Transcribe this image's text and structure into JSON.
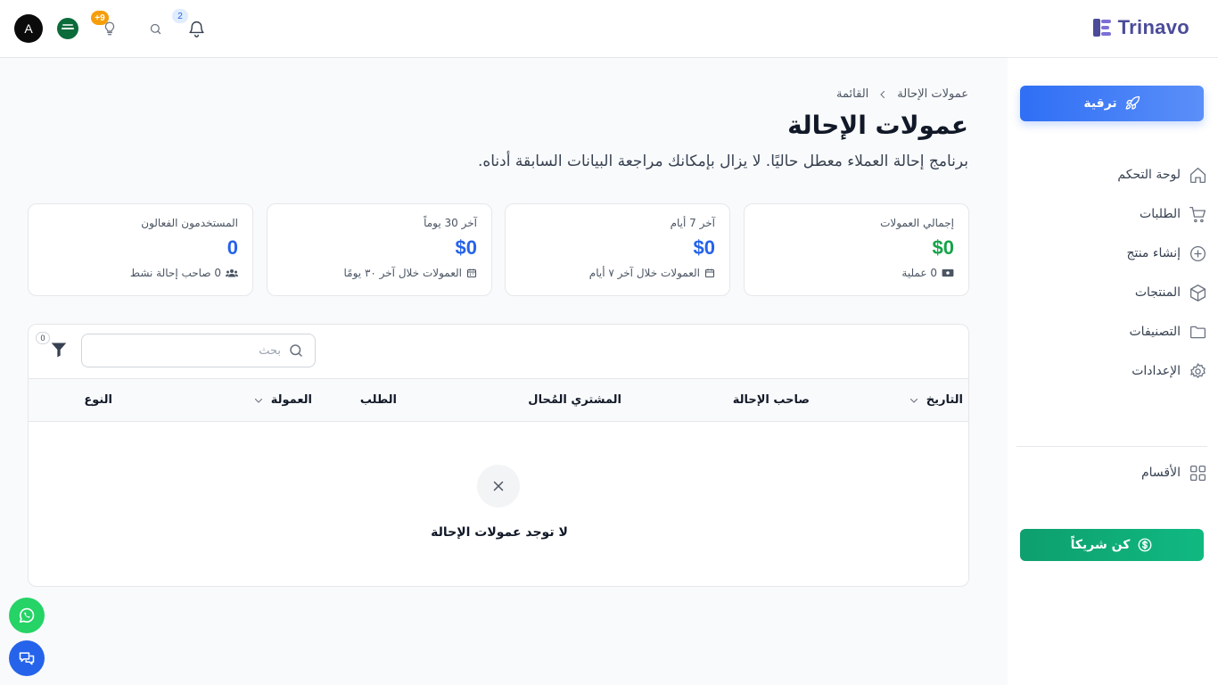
{
  "header": {
    "brand": "Trinavo",
    "avatar_letter": "A",
    "tips_badge": "+9",
    "notifications_badge": "2"
  },
  "sidebar": {
    "upgrade_label": "ترقية",
    "items": [
      {
        "label": "لوحة التحكم",
        "icon": "home-icon"
      },
      {
        "label": "الطلبات",
        "icon": "cart-icon"
      },
      {
        "label": "إنشاء منتج",
        "icon": "plus-circle-icon"
      },
      {
        "label": "المنتجات",
        "icon": "box-icon"
      },
      {
        "label": "التصنيفات",
        "icon": "folder-icon"
      },
      {
        "label": "الإعدادات",
        "icon": "gear-icon"
      }
    ],
    "sections_label": "الأقسام",
    "partner_label": "كن شريكاً"
  },
  "breadcrumb": {
    "parent": "القائمة",
    "current": "عمولات الإحالة"
  },
  "page": {
    "title": "عمولات الإحالة",
    "description": "برنامج إحالة العملاء معطل حاليًا. لا يزال بإمكانك مراجعة البيانات السابقة أدناه."
  },
  "stats": [
    {
      "label": "إجمالي العمولات",
      "value": "$0",
      "sub": "0 عملية",
      "color": "#16a34a"
    },
    {
      "label": "آخر 7 أيام",
      "value": "$0",
      "sub": "العمولات خلال آخر ٧ أيام",
      "color": "#2563eb"
    },
    {
      "label": "آخر 30 يوماً",
      "value": "$0",
      "sub": "العمولات خلال آخر ٣٠ يومًا",
      "color": "#2563eb"
    },
    {
      "label": "المستخدمون الفعالون",
      "value": "0",
      "sub": "0 صاحب إحالة نشط",
      "color": "#2563eb"
    }
  ],
  "table": {
    "search_placeholder": "بحث",
    "filter_count": "0",
    "columns": {
      "date": "التاريخ",
      "referrer": "صاحب الإحالة",
      "buyer": "المشتري المُحال",
      "order": "الطلب",
      "commission": "العمولة",
      "type": "النوع"
    },
    "empty_message": "لا توجد عمولات الإحالة"
  }
}
